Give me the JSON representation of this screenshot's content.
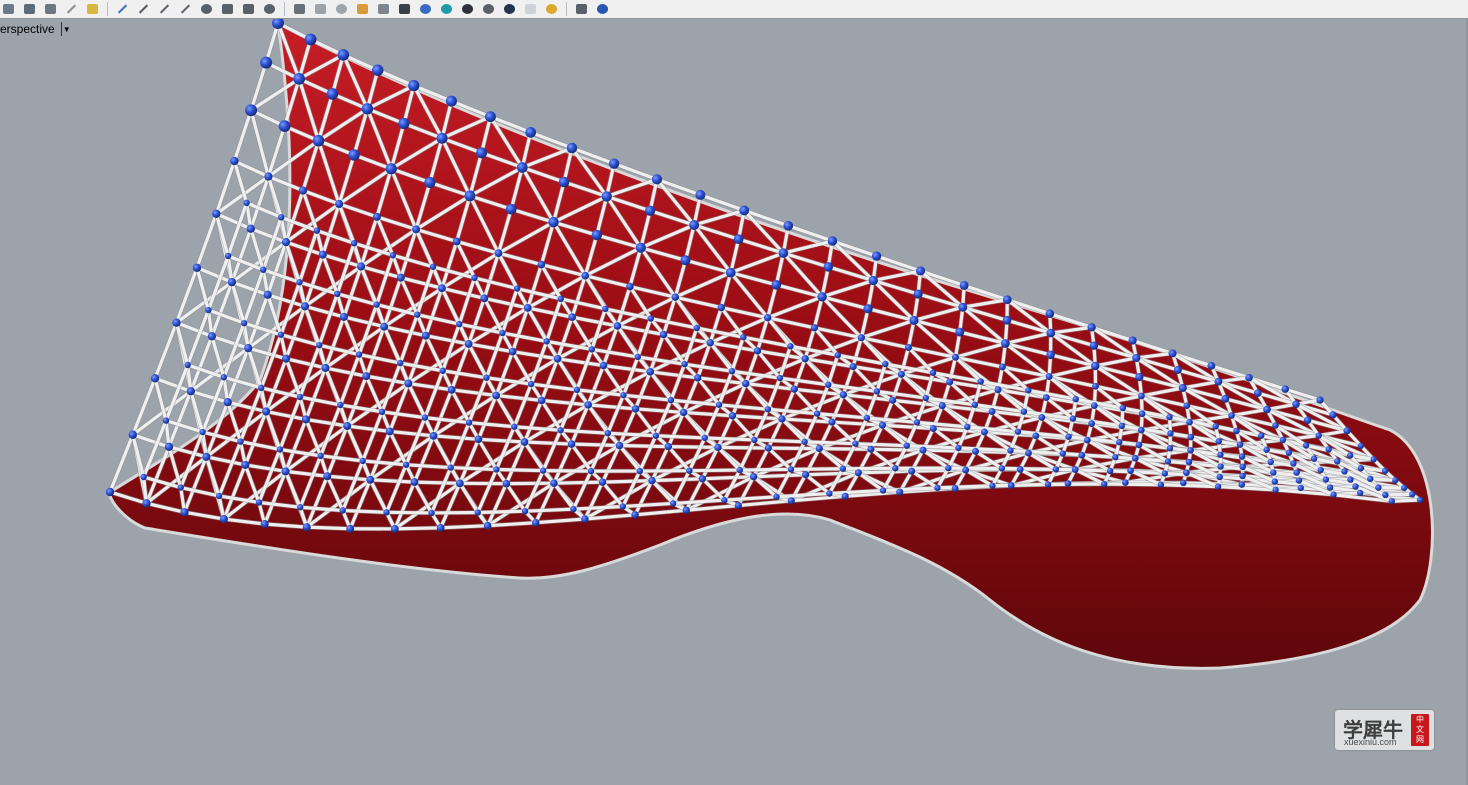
{
  "toolbar": {
    "tools": [
      {
        "icon": "save-icon",
        "color": "#6b7a88"
      },
      {
        "icon": "print-icon",
        "color": "#5e6b78"
      },
      {
        "icon": "copy-icon",
        "color": "#6d7682"
      },
      {
        "icon": "cut-icon",
        "color": "#8a8f96"
      },
      {
        "icon": "paste-icon",
        "color": "#d8b640"
      },
      {
        "icon": "undo-icon",
        "color": "#3b74c2"
      },
      {
        "icon": "select-icon",
        "color": "#555b63"
      },
      {
        "icon": "pan-icon",
        "color": "#5e646c"
      },
      {
        "icon": "rotate-icon",
        "color": "#5e646c"
      },
      {
        "icon": "zoom-icon",
        "color": "#5a6068"
      },
      {
        "icon": "zoom-window-icon",
        "color": "#5a6068"
      },
      {
        "icon": "zoom-extents-icon",
        "color": "#5a6068"
      },
      {
        "icon": "zoom-selected-icon",
        "color": "#5a6068"
      },
      {
        "icon": "viewport-layout-icon",
        "color": "#6a7078"
      },
      {
        "icon": "grid-icon",
        "color": "#9ea3a8"
      },
      {
        "icon": "cplane-icon",
        "color": "#a0a5aa"
      },
      {
        "icon": "object-properties-icon",
        "color": "#d89a3a"
      },
      {
        "icon": "light-icon",
        "color": "#7f858c"
      },
      {
        "icon": "layer-icon",
        "color": "#3a4048"
      },
      {
        "icon": "render-preview-icon",
        "color": "#3a6bc2"
      },
      {
        "icon": "render-globe-icon",
        "color": "#1f9aa8"
      },
      {
        "icon": "material-icon",
        "color": "#2e3238"
      },
      {
        "icon": "rendered-sphere-icon",
        "color": "#5a5f66"
      },
      {
        "icon": "shaded-sphere-icon",
        "color": "#24344e"
      },
      {
        "icon": "environment-icon",
        "color": "#cfd3d7"
      },
      {
        "icon": "sun-icon",
        "color": "#d9aa2c"
      },
      {
        "icon": "toolbar-layout-icon",
        "color": "#5a6068"
      },
      {
        "icon": "help-icon",
        "color": "#2a56b3"
      }
    ]
  },
  "viewport": {
    "name": "erspective",
    "dropdown_glyph": "▼"
  },
  "scene": {
    "membrane_color": "#9c0d14",
    "membrane_dark": "#6a080c",
    "strut_color": "#eeeeee",
    "node_color": "#2a4fd1"
  },
  "watermark": {
    "cn": "学犀牛",
    "en": "xuexiniu.com",
    "stamp": [
      "中",
      "文",
      "网"
    ]
  }
}
